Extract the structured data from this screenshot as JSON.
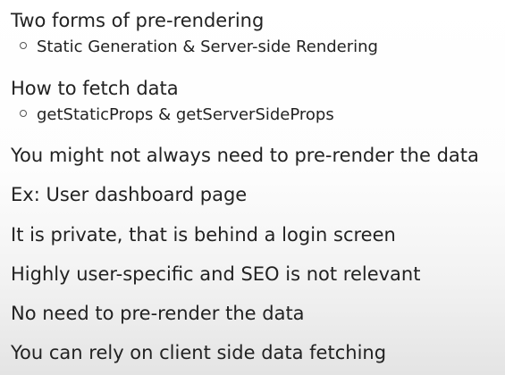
{
  "slide": {
    "lines": [
      "Two forms of pre-rendering",
      "Static Generation & Server-side Rendering",
      "How to fetch data",
      "getStaticProps & getServerSideProps",
      "You might not always need to pre-render the data",
      "Ex: User dashboard page",
      "It is private, that is behind a login screen",
      "Highly user-specific and SEO is not relevant",
      "No need to pre-render the data",
      "You can rely on client side data fetching"
    ]
  }
}
